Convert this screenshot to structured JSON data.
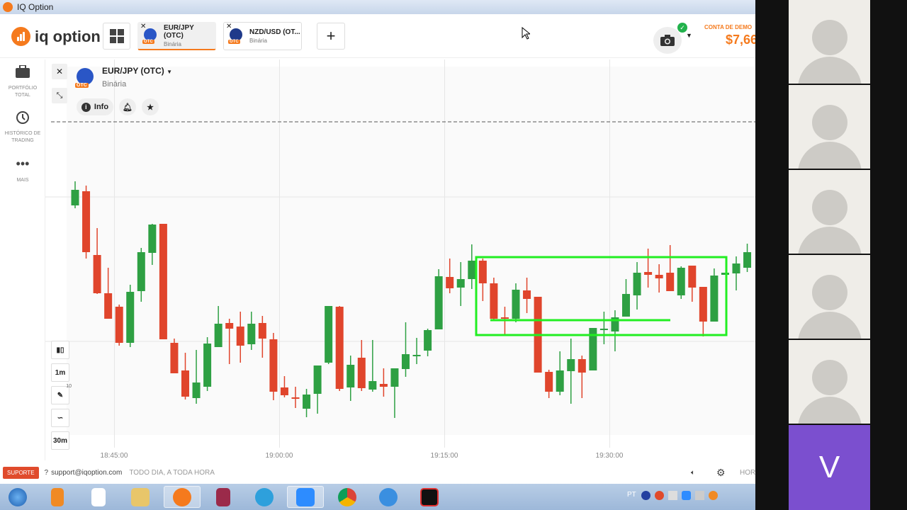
{
  "window": {
    "title": "IQ Option"
  },
  "header": {
    "brand": "iq option",
    "tabs": [
      {
        "label": "EUR/JPY (OTC)",
        "sub": "Binária",
        "badge": "OTC"
      },
      {
        "label": "NZD/USD (OT...",
        "sub": "Binária",
        "badge": "OTC"
      }
    ],
    "add": "+",
    "account_label": "CONTA DE DEMO",
    "balance": "$7,66"
  },
  "sidebar": {
    "items": [
      {
        "label": "PORTFÓLIO TOTAL",
        "icon": "briefcase-icon"
      },
      {
        "label": "HISTÓRICO DE TRADING",
        "icon": "history-icon"
      },
      {
        "label": "MAIS",
        "icon": "more-icon"
      }
    ]
  },
  "asset": {
    "name": "EUR/JPY (OTC)",
    "type": "Binária",
    "badge": "OTC",
    "info": "Info"
  },
  "tools": {
    "timeframe": "1m",
    "drawings_count": "10",
    "expiry": "30m"
  },
  "chart_data": {
    "type": "candlestick",
    "x_ticks": [
      "18:45:00",
      "19:00:00",
      "19:15:00",
      "19:30:00"
    ],
    "ohlc_note": "values in relative price units",
    "candles": [
      [
        310,
        344,
        306,
        332
      ],
      [
        330,
        338,
        235,
        244
      ],
      [
        240,
        278,
        185,
        186
      ],
      [
        186,
        222,
        150,
        150
      ],
      [
        167,
        170,
        112,
        116
      ],
      [
        116,
        198,
        110,
        188
      ],
      [
        189,
        250,
        174,
        244
      ],
      [
        243,
        284,
        226,
        283
      ],
      [
        284,
        284,
        121,
        121
      ],
      [
        116,
        122,
        73,
        73
      ],
      [
        77,
        102,
        36,
        40
      ],
      [
        38,
        106,
        30,
        60
      ],
      [
        54,
        124,
        48,
        115
      ],
      [
        110,
        168,
        110,
        143
      ],
      [
        144,
        150,
        86,
        136
      ],
      [
        139,
        160,
        88,
        112
      ],
      [
        114,
        160,
        106,
        143
      ],
      [
        144,
        154,
        95,
        122
      ],
      [
        121,
        130,
        35,
        47
      ],
      [
        53,
        69,
        39,
        42
      ],
      [
        39,
        54,
        24,
        37
      ],
      [
        23,
        51,
        11,
        43
      ],
      [
        44,
        84,
        16,
        84
      ],
      [
        88,
        168,
        86,
        168
      ],
      [
        167,
        168,
        48,
        51
      ],
      [
        53,
        98,
        34,
        85
      ],
      [
        95,
        120,
        48,
        52
      ],
      [
        50,
        120,
        47,
        62
      ],
      [
        58,
        80,
        40,
        54
      ],
      [
        54,
        80,
        10,
        80
      ],
      [
        79,
        145,
        68,
        100
      ],
      [
        99,
        123,
        86,
        99
      ],
      [
        105,
        136,
        97,
        134
      ],
      [
        135,
        220,
        135,
        210
      ],
      [
        209,
        235,
        186,
        193
      ],
      [
        194,
        230,
        168,
        206
      ],
      [
        206,
        255,
        192,
        232
      ],
      [
        232,
        235,
        175,
        200
      ],
      [
        200,
        208,
        148,
        150
      ],
      [
        152,
        167,
        128,
        150
      ],
      [
        150,
        200,
        145,
        191
      ],
      [
        190,
        208,
        158,
        178
      ],
      [
        181,
        181,
        74,
        74
      ],
      [
        75,
        78,
        38,
        47
      ],
      [
        47,
        104,
        42,
        77
      ],
      [
        76,
        122,
        30,
        93
      ],
      [
        93,
        98,
        38,
        74
      ],
      [
        77,
        137,
        77,
        137
      ],
      [
        136,
        160,
        114,
        136
      ],
      [
        132,
        162,
        104,
        152
      ],
      [
        153,
        206,
        153,
        185
      ],
      [
        183,
        230,
        163,
        215
      ],
      [
        216,
        249,
        194,
        212
      ],
      [
        212,
        227,
        187,
        207
      ],
      [
        215,
        254,
        189,
        189
      ],
      [
        183,
        224,
        178,
        222
      ],
      [
        225,
        225,
        174,
        194
      ],
      [
        195,
        195,
        125,
        146
      ],
      [
        146,
        221,
        146,
        211
      ],
      [
        212,
        215,
        212,
        215
      ],
      [
        214,
        238,
        190,
        228
      ],
      [
        222,
        256,
        216,
        244
      ]
    ],
    "colors": {
      "up": "#2ea043",
      "down": "#e0452c",
      "annotation": "#22ee22"
    }
  },
  "footer": {
    "support": "SUPORTE",
    "email": "support@iqoption.com",
    "hours": "TODO DIA, A TODA HORA",
    "right": "HOR"
  },
  "taskbar": {
    "lang": "PT"
  },
  "video": {
    "last_initial": "V"
  }
}
